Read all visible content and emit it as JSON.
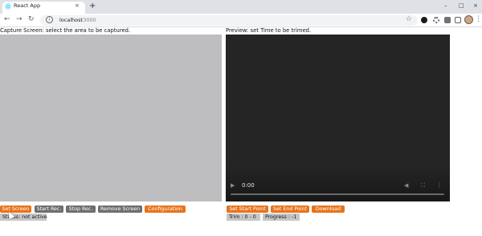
{
  "browser": {
    "tab_title": "React App",
    "tab_close": "×",
    "new_tab": "+",
    "url_host": "localhost",
    "url_port": ":3000",
    "back": "←",
    "forward": "→",
    "reload": "↻",
    "info_icon": "i",
    "star": "☆",
    "menu": "⋮",
    "window_controls": [
      "–",
      "□",
      "×"
    ]
  },
  "capture": {
    "caption": "Capture Screen: select the area to be captured.",
    "buttons": [
      "Set Screen",
      "Start Rec.",
      "Stop Rec.",
      "Remove Screen",
      "Configuration"
    ],
    "status": "Status: not active"
  },
  "preview": {
    "caption": "Preview: set Time to be trimed.",
    "video_time": "0:00",
    "buttons": [
      "Set Start Point",
      "Set End Point",
      "Download"
    ],
    "trim": "Trim : 0 - 0",
    "progress": "Progress : -1"
  },
  "colors": {
    "accent": "#e8731a",
    "neutral_button": "#6e6e6e",
    "capture_area": "#bebdbf",
    "video_bg": "#252525"
  }
}
